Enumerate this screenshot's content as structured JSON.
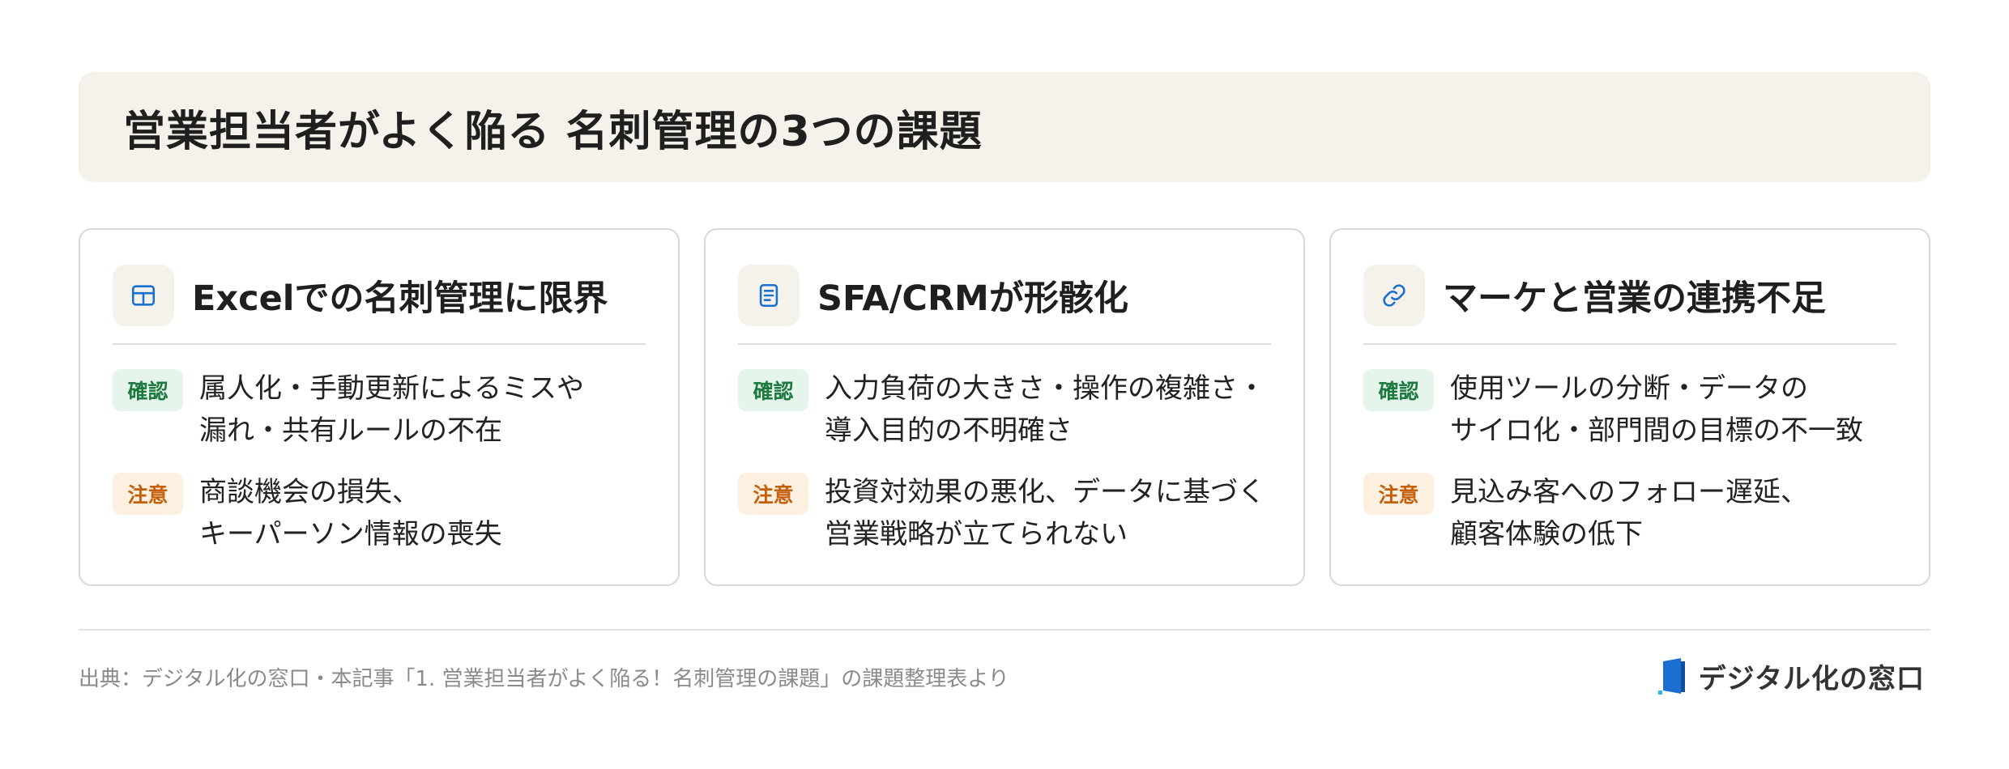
{
  "page_title": "営業担当者がよく陥る 名刺管理の3つの課題",
  "cards": [
    {
      "icon": "table-icon",
      "title": "Excelでの名刺管理に限界",
      "confirm_label": "確認",
      "confirm_lines": [
        "属人化・手動更新によるミスや",
        "漏れ・共有ルールの不在"
      ],
      "caution_label": "注意",
      "caution_lines": [
        "商談機会の損失、",
        "キーパーソン情報の喪失"
      ]
    },
    {
      "icon": "document-icon",
      "title": "SFA/CRMが形骸化",
      "confirm_label": "確認",
      "confirm_lines": [
        "入力負荷の大きさ・操作の複雑さ・",
        "導入目的の不明確さ"
      ],
      "caution_label": "注意",
      "caution_lines": [
        "投資対効果の悪化、データに基づく",
        "営業戦略が立てられない"
      ]
    },
    {
      "icon": "link-icon",
      "title": "マーケと営業の連携不足",
      "confirm_label": "確認",
      "confirm_lines": [
        "使用ツールの分断・データの",
        "サイロ化・部門間の目標の不一致"
      ],
      "caution_label": "注意",
      "caution_lines": [
        "見込み客へのフォロー遅延、",
        "顧客体験の低下"
      ]
    }
  ],
  "footer": {
    "source": "出典：デジタル化の窓口・本記事「1. 営業担当者がよく陥る！名刺管理の課題」の課題整理表より",
    "brand_name": "デジタル化の窓口",
    "brand_icon": "door-logo-icon"
  },
  "colors": {
    "icon_blue": "#1a6fd0",
    "confirm_text": "#1d7a3e",
    "confirm_bg": "#e6f5ec",
    "caution_text": "#c45f0a",
    "caution_bg": "#fdf0e1",
    "panel_bg": "#f5f2ec"
  }
}
